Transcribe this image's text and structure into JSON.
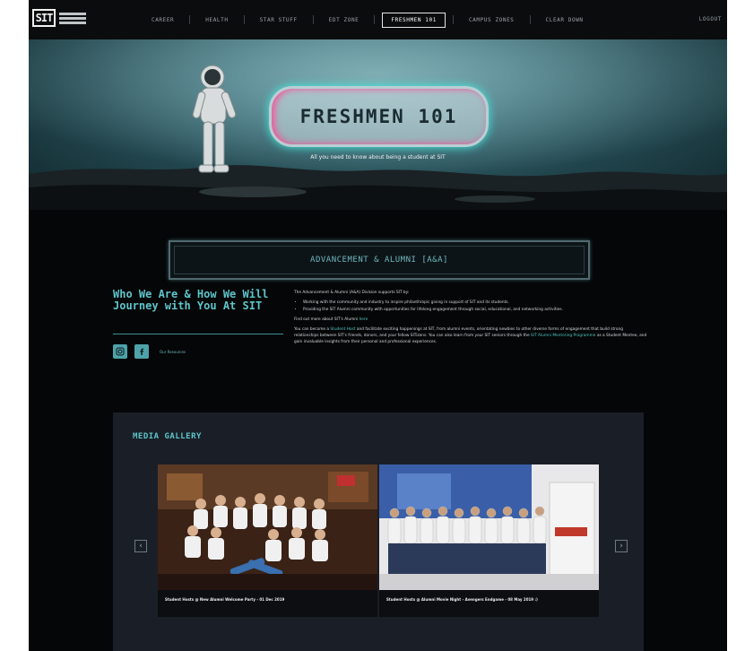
{
  "nav": {
    "logo_mark": "SIT",
    "items": [
      {
        "label": "CAREER",
        "active": false
      },
      {
        "label": "HEALTH",
        "active": false
      },
      {
        "label": "STAR STUFF",
        "active": false
      },
      {
        "label": "EDT ZONE",
        "active": false
      },
      {
        "label": "FRESHMEN 101",
        "active": true
      },
      {
        "label": "CAMPUS ZONES",
        "active": false
      },
      {
        "label": "CLEAR DOWN",
        "active": false
      }
    ],
    "logout": "LOGOUT"
  },
  "hero": {
    "title": "FRESHMEN 101",
    "subtitle": "All you need to know about being a student at SIT"
  },
  "section": {
    "title": "ADVANCEMENT & ALUMNI [A&A]"
  },
  "about": {
    "heading": "Who We Are & How We Will Journey with You At SIT",
    "social_link": "Our Resources",
    "intro": "The Advancement & Alumni (A&A) Division supports SIT by:",
    "bullets": [
      "Working with the community and industry to inspire philanthropic giving in support of SIT and its students.",
      "Providing the SIT Alumni community with opportunities for lifelong engagement through social, educational, and networking activities."
    ],
    "find_out_prefix": "Find out more about SIT's Alumni ",
    "find_out_link": "here",
    "para_a": "You can become a ",
    "para_link1": "Student Host",
    "para_b": " and facilitate exciting happenings at SIT, from alumni events, orientating newbies to other diverse forms of engagement that build strong relationships between SIT's friends, donors, and your fellow SITizens. You can also learn from your SIT seniors through the ",
    "para_link2": "SIT Alumni Mentoring Programme",
    "para_c": " as a Student Mentee, and gain invaluable insights from their personal and professional experiences."
  },
  "gallery": {
    "title": "MEDIA GALLERY",
    "slides": [
      {
        "caption": "Student Hosts @ New Alumni Welcome Party - 01 Dec 2019"
      },
      {
        "caption": "Student Hosts @ Alumni Movie Night - Avengers Endgame - 08 May 2019 :)"
      }
    ],
    "prev": "‹",
    "next": "›"
  }
}
